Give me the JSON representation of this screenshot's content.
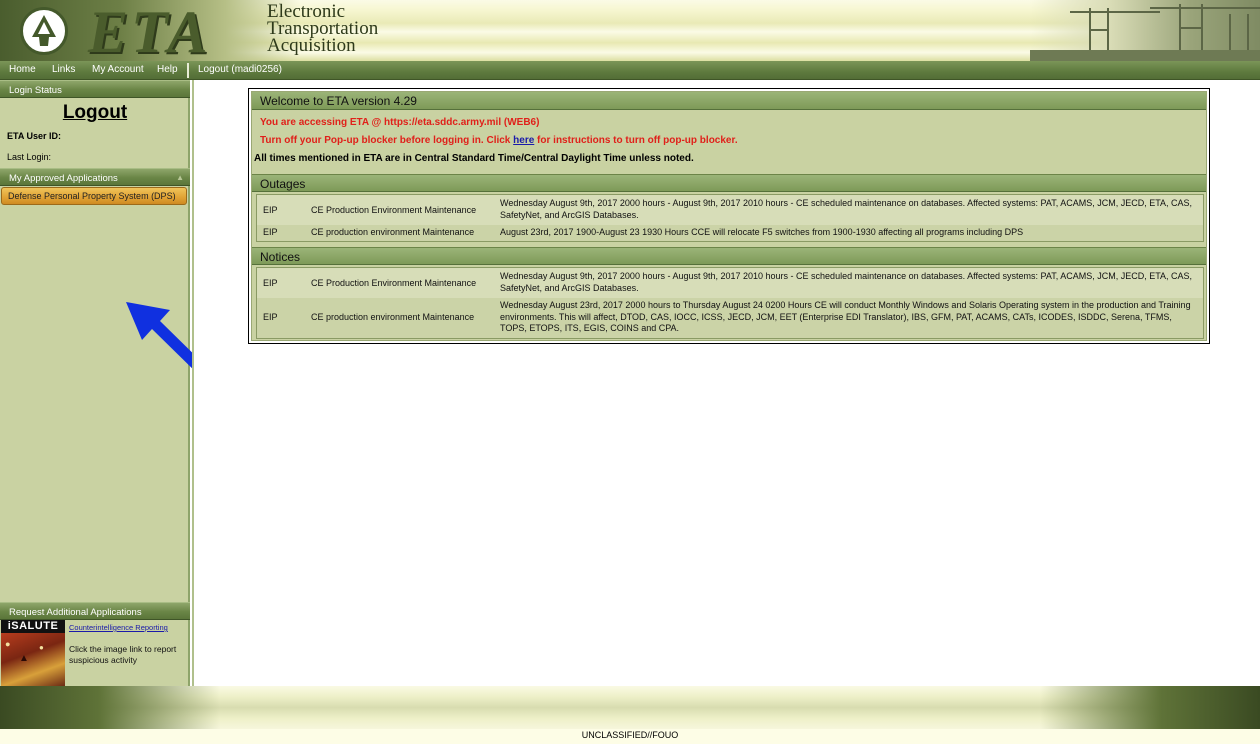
{
  "header": {
    "logo_letters": "ETA",
    "subtitle_lines": [
      "Electronic",
      "Transportation",
      "Acquisition"
    ]
  },
  "nav": {
    "items": [
      "Home",
      "Links",
      "My Account",
      "Help"
    ],
    "logout": "Logout (madi0256)"
  },
  "sidebar": {
    "login_status_header": "Login Status",
    "logout_label": "Logout",
    "user_id_label": "ETA User ID:",
    "last_login_label": "Last Login:",
    "approved_apps_header": "My Approved Applications",
    "apps": [
      "Defense Personal Property System (DPS)"
    ],
    "request_header": "Request Additional Applications",
    "isalute": {
      "badge": "iSALUTE",
      "link": "Counterintelligence Reporting",
      "text": "Click the image link to report suspicious activity"
    }
  },
  "welcome": {
    "title": "Welcome to ETA version 4.29",
    "access_msg": "You are accessing ETA @ https://eta.sddc.army.mil (WEB6)",
    "popup_msg_before": "Turn off your Pop-up blocker before logging in. Click ",
    "popup_link": "here",
    "popup_msg_after": " for instructions to turn off pop-up blocker.",
    "time_msg": "All times mentioned in ETA are in Central Standard Time/Central Daylight Time unless noted."
  },
  "outages": {
    "title": "Outages",
    "rows": [
      {
        "code": "EIP",
        "name": "CE Production Environment Maintenance",
        "detail": "Wednesday August 9th, 2017 2000 hours - August 9th, 2017 2010 hours - CE scheduled maintenance on databases. Affected systems: PAT, ACAMS, JCM, JECD, ETA, CAS, SafetyNet, and ArcGIS Databases."
      },
      {
        "code": "EIP",
        "name": "CE production environment Maintenance",
        "detail": "August 23rd, 2017 1900-August 23 1930 Hours CCE will relocate F5 switches from 1900-1930 affecting all programs including DPS"
      }
    ]
  },
  "notices": {
    "title": "Notices",
    "rows": [
      {
        "code": "EIP",
        "name": "CE Production Environment Maintenance",
        "detail": "Wednesday August 9th, 2017 2000 hours - August 9th, 2017 2010 hours - CE scheduled maintenance on databases. Affected systems: PAT, ACAMS, JCM, JECD, ETA, CAS, SafetyNet, and ArcGIS Databases."
      },
      {
        "code": "EIP",
        "name": "CE production environment Maintenance",
        "detail": "Wednesday August 23rd, 2017 2000 hours to Thursday August 24 0200 Hours CE will conduct Monthly Windows and Solaris Operating system in the production and Training environments. This will affect, DTOD, CAS, IOCC, ICSS, JECD, JCM, EET (Enterprise EDI Translator), IBS, GFM, PAT, ACAMS, CATs, ICODES, ISDDC, Serena, TFMS, TOPS, ETOPS, ITS, EGIS, COINS and CPA."
      }
    ]
  },
  "footer": {
    "classification": "UNCLASSIFIED//FOUO"
  },
  "colors": {
    "accent_green": "#5e7a3e",
    "panel_bg": "#c9d2a2",
    "alert_red": "#e0201a",
    "app_item_orange": "#e0a234",
    "annotation_arrow": "#1030e0"
  }
}
